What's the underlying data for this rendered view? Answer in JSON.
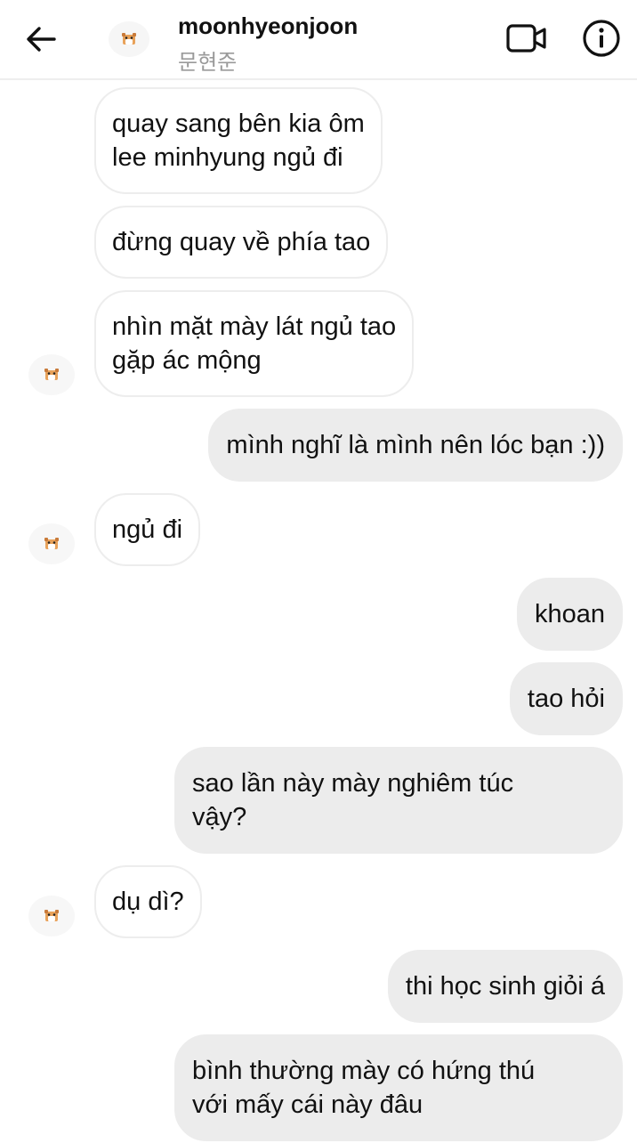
{
  "header": {
    "username": "moonhyeonjoon",
    "subtitle": "문현준",
    "back_icon": "arrow-left-icon",
    "video_icon": "video-camera-icon",
    "info_icon": "info-icon"
  },
  "messages": [
    {
      "from": "them",
      "text_lines": [
        "quay sang bên kia ôm",
        "lee minhyung ngủ đi"
      ]
    },
    {
      "from": "them",
      "text_lines": [
        "đừng quay về phía tao"
      ]
    },
    {
      "from": "them",
      "text_lines": [
        "nhìn mặt mày lát ngủ tao",
        "gặp ác mộng"
      ]
    },
    {
      "from": "me",
      "text_lines": [
        "mình nghĩ là mình nên lóc bạn :))"
      ]
    },
    {
      "from": "them",
      "text_lines": [
        "ngủ đi"
      ]
    },
    {
      "from": "me",
      "text_lines": [
        "khoan"
      ]
    },
    {
      "from": "me",
      "text_lines": [
        "tao hỏi"
      ]
    },
    {
      "from": "me",
      "text_lines": [
        "sao lần này mày nghiêm túc",
        "vậy?"
      ]
    },
    {
      "from": "them",
      "text_lines": [
        "dụ dì?"
      ]
    },
    {
      "from": "me",
      "text_lines": [
        "thi học sinh giỏi á"
      ]
    },
    {
      "from": "me",
      "text_lines": [
        "bình thường mày có hứng thú",
        "với mấy cái này đâu"
      ]
    }
  ],
  "colors": {
    "outgoing_bubble": "#ececec",
    "incoming_border": "#ededed",
    "subtitle": "#9a9a9a"
  }
}
